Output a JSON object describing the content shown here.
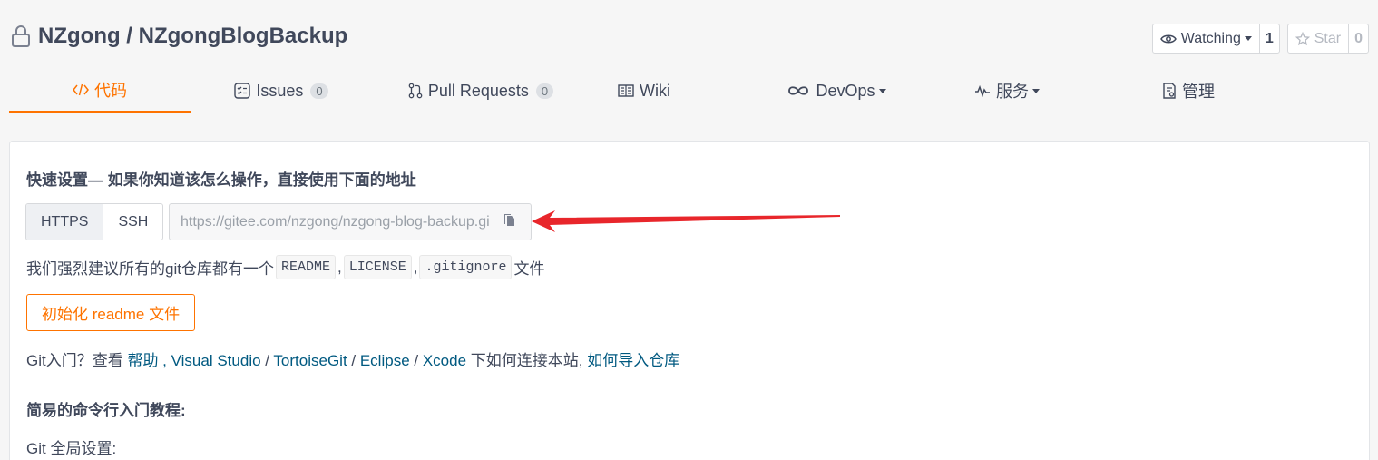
{
  "repo": {
    "title": "NZgong / NZgongBlogBackup"
  },
  "actions": {
    "watch_label": "Watching",
    "watch_count": "1",
    "star_label": "Star",
    "star_count": "0"
  },
  "tabs": [
    {
      "label": "代码",
      "badge": ""
    },
    {
      "label": "Issues",
      "badge": "0"
    },
    {
      "label": "Pull Requests",
      "badge": "0"
    },
    {
      "label": "Wiki",
      "badge": ""
    },
    {
      "label": "DevOps",
      "badge": ""
    },
    {
      "label": "服务",
      "badge": ""
    },
    {
      "label": "管理",
      "badge": ""
    }
  ],
  "quick": {
    "heading": "快速设置— 如果你知道该怎么操作，直接使用下面的地址",
    "https": "HTTPS",
    "ssh": "SSH",
    "url": "https://gitee.com/nzgong/nzgong-blog-backup.git",
    "recommend_pre": "我们强烈建议所有的git仓库都有一个",
    "file1": "README",
    "file2": "LICENSE",
    "file3": ".gitignore",
    "sep": ",",
    "recommend_post": "文件",
    "init_button": "初始化 readme 文件"
  },
  "intro": {
    "prefix": "Git入门？查看 ",
    "help": "帮助",
    "vs": "Visual Studio",
    "tortoise": "TortoiseGit",
    "eclipse": "Eclipse",
    "xcode": "Xcode",
    "mid": " 下如何连接本站, ",
    "import": "如何导入仓库"
  },
  "tutorial": {
    "heading": "简易的命令行入门教程:",
    "global": "Git 全局设置:"
  },
  "colors": {
    "accent": "#fe7300",
    "link": "#005980",
    "arrow": "#e8262b"
  }
}
